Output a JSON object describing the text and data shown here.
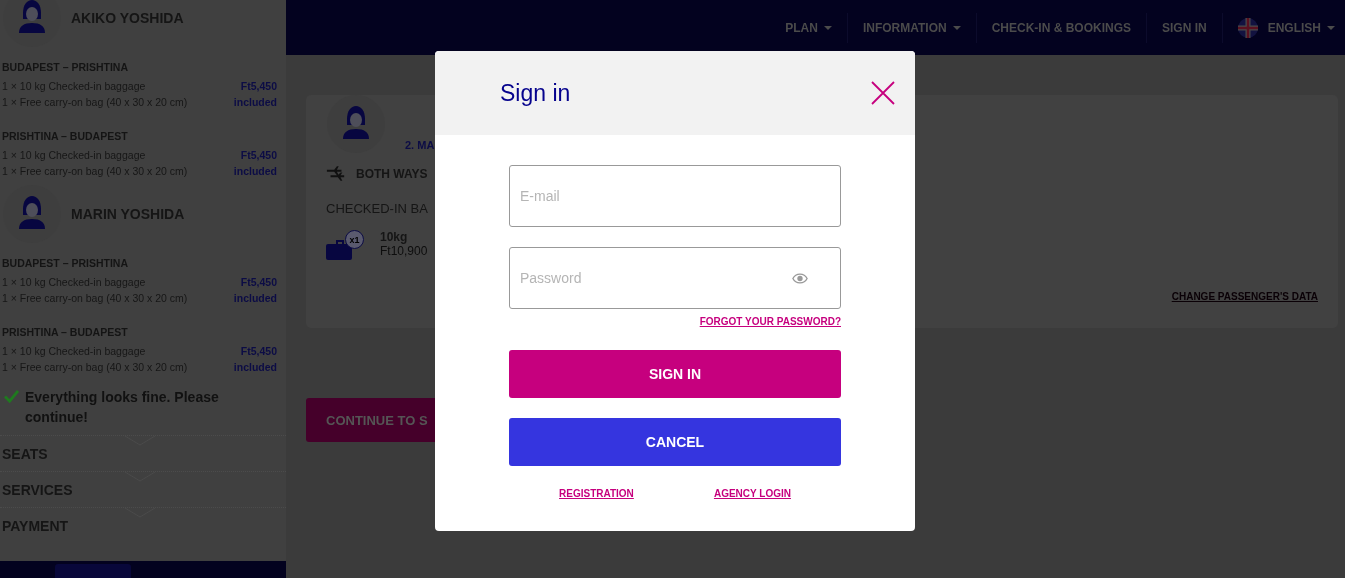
{
  "nav": {
    "items": [
      {
        "label": "PLAN",
        "dropdown": true
      },
      {
        "label": "INFORMATION",
        "dropdown": true
      },
      {
        "label": "CHECK-IN & BOOKINGS",
        "dropdown": false
      },
      {
        "label": "SIGN IN",
        "dropdown": false
      }
    ],
    "language": {
      "label": "ENGLISH",
      "dropdown": true
    }
  },
  "sidebar": {
    "passengers": [
      {
        "name": "AKIKO YOSHIDA",
        "legs": [
          {
            "route": "BUDAPEST – PRISHTINA",
            "items": [
              {
                "text": "1 × 10 kg Checked-in baggage",
                "price": "Ft5,450"
              },
              {
                "text": "1 × Free carry-on bag (40 x 30 x 20 cm)",
                "price": "included"
              }
            ]
          },
          {
            "route": "PRISHTINA – BUDAPEST",
            "items": [
              {
                "text": "1 × 10 kg Checked-in baggage",
                "price": "Ft5,450"
              },
              {
                "text": "1 × Free carry-on bag (40 x 30 x 20 cm)",
                "price": "included"
              }
            ]
          }
        ]
      },
      {
        "name": "MARIN YOSHIDA",
        "legs": [
          {
            "route": "BUDAPEST – PRISHTINA",
            "items": [
              {
                "text": "1 × 10 kg Checked-in baggage",
                "price": "Ft5,450"
              },
              {
                "text": "1 × Free carry-on bag (40 x 30 x 20 cm)",
                "price": "included"
              }
            ]
          },
          {
            "route": "PRISHTINA – BUDAPEST",
            "items": [
              {
                "text": "1 × 10 kg Checked-in baggage",
                "price": "Ft5,450"
              },
              {
                "text": "1 × Free carry-on bag (40 x 30 x 20 cm)",
                "price": "included"
              }
            ]
          }
        ]
      }
    ],
    "status": "Everything looks fine. Please continue!",
    "sections": [
      {
        "label": "SEATS"
      },
      {
        "label": "SERVICES"
      },
      {
        "label": "PAYMENT"
      }
    ]
  },
  "passenger_card": {
    "number": "2. MA",
    "trip": "BOTH WAYS",
    "heading": "CHECKED-IN BA",
    "bag": {
      "count": "x1",
      "weight": "10kg",
      "price": "Ft10,900"
    },
    "link": "CHANGE PASSENGER'S DATA"
  },
  "continue_button": "CONTINUE TO S",
  "modal": {
    "title": "Sign in",
    "email": {
      "placeholder": "E-mail"
    },
    "password": {
      "placeholder": "Password"
    },
    "forgot": "FORGOT YOUR PASSWORD?",
    "sign_in": "SIGN IN",
    "cancel": "CANCEL",
    "links": [
      "REGISTRATION",
      "AGENCY LOGIN"
    ]
  }
}
